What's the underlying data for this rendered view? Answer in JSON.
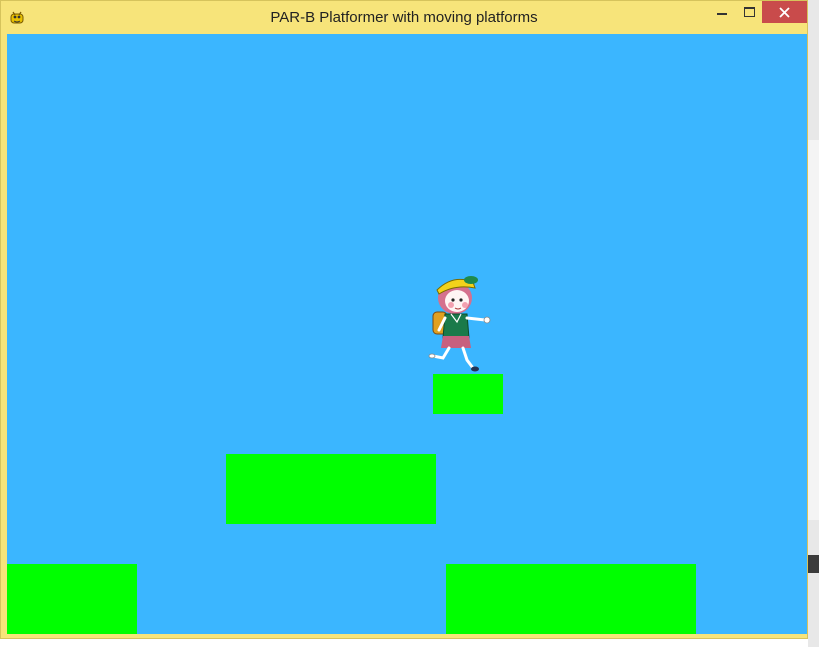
{
  "window": {
    "title": "PAR-B Platformer with moving platforms",
    "app_icon": "pygame-snake-icon",
    "controls": [
      "minimize-icon",
      "maximize-icon",
      "close-icon"
    ]
  },
  "game": {
    "background_color": "#3bb6ff",
    "platform_color": "#00ff00",
    "player": {
      "sprite": "girl-with-yellow-hat-and-backpack-running"
    },
    "platform_count": 4
  }
}
